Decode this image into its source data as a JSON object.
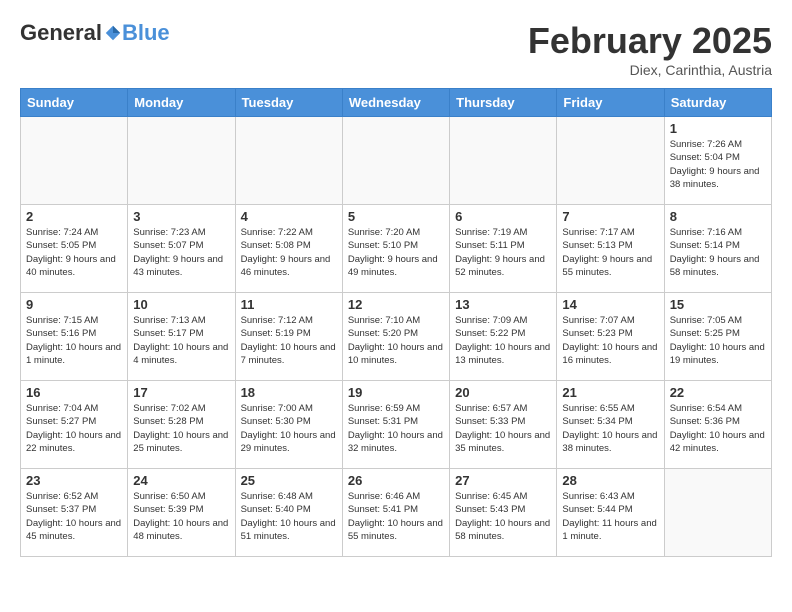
{
  "header": {
    "logo_general": "General",
    "logo_blue": "Blue",
    "month_year": "February 2025",
    "location": "Diex, Carinthia, Austria"
  },
  "weekdays": [
    "Sunday",
    "Monday",
    "Tuesday",
    "Wednesday",
    "Thursday",
    "Friday",
    "Saturday"
  ],
  "weeks": [
    [
      {
        "day": "",
        "info": ""
      },
      {
        "day": "",
        "info": ""
      },
      {
        "day": "",
        "info": ""
      },
      {
        "day": "",
        "info": ""
      },
      {
        "day": "",
        "info": ""
      },
      {
        "day": "",
        "info": ""
      },
      {
        "day": "1",
        "info": "Sunrise: 7:26 AM\nSunset: 5:04 PM\nDaylight: 9 hours and 38 minutes."
      }
    ],
    [
      {
        "day": "2",
        "info": "Sunrise: 7:24 AM\nSunset: 5:05 PM\nDaylight: 9 hours and 40 minutes."
      },
      {
        "day": "3",
        "info": "Sunrise: 7:23 AM\nSunset: 5:07 PM\nDaylight: 9 hours and 43 minutes."
      },
      {
        "day": "4",
        "info": "Sunrise: 7:22 AM\nSunset: 5:08 PM\nDaylight: 9 hours and 46 minutes."
      },
      {
        "day": "5",
        "info": "Sunrise: 7:20 AM\nSunset: 5:10 PM\nDaylight: 9 hours and 49 minutes."
      },
      {
        "day": "6",
        "info": "Sunrise: 7:19 AM\nSunset: 5:11 PM\nDaylight: 9 hours and 52 minutes."
      },
      {
        "day": "7",
        "info": "Sunrise: 7:17 AM\nSunset: 5:13 PM\nDaylight: 9 hours and 55 minutes."
      },
      {
        "day": "8",
        "info": "Sunrise: 7:16 AM\nSunset: 5:14 PM\nDaylight: 9 hours and 58 minutes."
      }
    ],
    [
      {
        "day": "9",
        "info": "Sunrise: 7:15 AM\nSunset: 5:16 PM\nDaylight: 10 hours and 1 minute."
      },
      {
        "day": "10",
        "info": "Sunrise: 7:13 AM\nSunset: 5:17 PM\nDaylight: 10 hours and 4 minutes."
      },
      {
        "day": "11",
        "info": "Sunrise: 7:12 AM\nSunset: 5:19 PM\nDaylight: 10 hours and 7 minutes."
      },
      {
        "day": "12",
        "info": "Sunrise: 7:10 AM\nSunset: 5:20 PM\nDaylight: 10 hours and 10 minutes."
      },
      {
        "day": "13",
        "info": "Sunrise: 7:09 AM\nSunset: 5:22 PM\nDaylight: 10 hours and 13 minutes."
      },
      {
        "day": "14",
        "info": "Sunrise: 7:07 AM\nSunset: 5:23 PM\nDaylight: 10 hours and 16 minutes."
      },
      {
        "day": "15",
        "info": "Sunrise: 7:05 AM\nSunset: 5:25 PM\nDaylight: 10 hours and 19 minutes."
      }
    ],
    [
      {
        "day": "16",
        "info": "Sunrise: 7:04 AM\nSunset: 5:27 PM\nDaylight: 10 hours and 22 minutes."
      },
      {
        "day": "17",
        "info": "Sunrise: 7:02 AM\nSunset: 5:28 PM\nDaylight: 10 hours and 25 minutes."
      },
      {
        "day": "18",
        "info": "Sunrise: 7:00 AM\nSunset: 5:30 PM\nDaylight: 10 hours and 29 minutes."
      },
      {
        "day": "19",
        "info": "Sunrise: 6:59 AM\nSunset: 5:31 PM\nDaylight: 10 hours and 32 minutes."
      },
      {
        "day": "20",
        "info": "Sunrise: 6:57 AM\nSunset: 5:33 PM\nDaylight: 10 hours and 35 minutes."
      },
      {
        "day": "21",
        "info": "Sunrise: 6:55 AM\nSunset: 5:34 PM\nDaylight: 10 hours and 38 minutes."
      },
      {
        "day": "22",
        "info": "Sunrise: 6:54 AM\nSunset: 5:36 PM\nDaylight: 10 hours and 42 minutes."
      }
    ],
    [
      {
        "day": "23",
        "info": "Sunrise: 6:52 AM\nSunset: 5:37 PM\nDaylight: 10 hours and 45 minutes."
      },
      {
        "day": "24",
        "info": "Sunrise: 6:50 AM\nSunset: 5:39 PM\nDaylight: 10 hours and 48 minutes."
      },
      {
        "day": "25",
        "info": "Sunrise: 6:48 AM\nSunset: 5:40 PM\nDaylight: 10 hours and 51 minutes."
      },
      {
        "day": "26",
        "info": "Sunrise: 6:46 AM\nSunset: 5:41 PM\nDaylight: 10 hours and 55 minutes."
      },
      {
        "day": "27",
        "info": "Sunrise: 6:45 AM\nSunset: 5:43 PM\nDaylight: 10 hours and 58 minutes."
      },
      {
        "day": "28",
        "info": "Sunrise: 6:43 AM\nSunset: 5:44 PM\nDaylight: 11 hours and 1 minute."
      },
      {
        "day": "",
        "info": ""
      }
    ]
  ]
}
